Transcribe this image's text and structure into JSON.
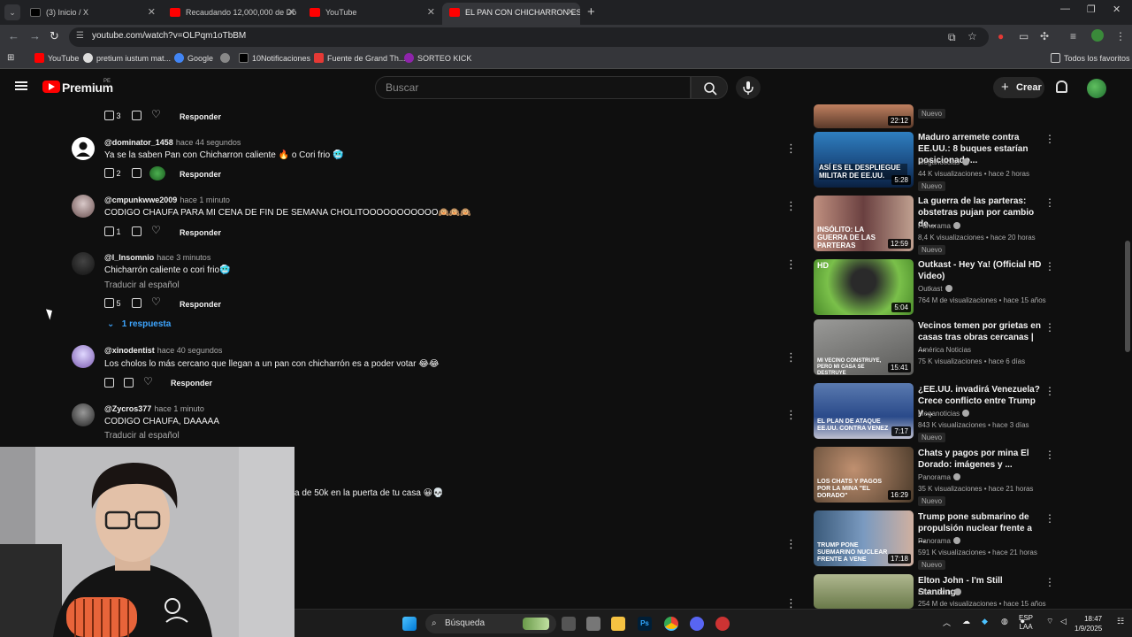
{
  "browser": {
    "tabs": [
      {
        "title": "(3) Inicio / X",
        "favicon": "x-logo-icon",
        "active": false
      },
      {
        "title": "Recaudando 12,000,000 de Dó",
        "favicon": "youtube-icon",
        "active": false
      },
      {
        "title": "YouTube",
        "favicon": "youtube-icon",
        "active": false
      },
      {
        "title": "EL PAN CON CHICHARRON ES",
        "favicon": "youtube-icon",
        "active": true
      }
    ],
    "url": "youtube.com/watch?v=OLPqm1oTbBM",
    "bookmarks": [
      {
        "label": "YouTube",
        "color": "#ff0000"
      },
      {
        "label": "pretium iustum mat...",
        "color": "#dddddd"
      },
      {
        "label": "Google",
        "color": "#4285f4"
      },
      {
        "label": "",
        "color": "#888888"
      },
      {
        "label": "10Notificaciones",
        "color": "#000000"
      },
      {
        "label": "Fuente de Grand Th...",
        "color": "#e53935"
      },
      {
        "label": "SORTEO KICK",
        "color": "#8e24aa"
      }
    ],
    "all_bookmarks": "Todos los favoritos"
  },
  "masthead": {
    "brand": "Premium",
    "country": "PE",
    "search_placeholder": "Buscar",
    "create_label": "Crear"
  },
  "comments": [
    {
      "author": "",
      "time": "",
      "text": "",
      "likes": "3",
      "reply": "Responder"
    },
    {
      "author": "@dominator_1458",
      "time": "hace 44 segundos",
      "text": "Ya se la saben Pan con Chicharron caliente 🔥 o Cori frio 🥶",
      "likes": "2",
      "reply": "Responder"
    },
    {
      "author": "@cmpunkwwe2009",
      "time": "hace 1 minuto",
      "text": "CODIGO CHAUFA PARA MI CENA DE FIN DE SEMANA CHOLITOOOOOOOOOOO🙉🙉🙉",
      "likes": "1",
      "reply": "Responder"
    },
    {
      "author": "@l_Insomnio",
      "time": "hace 3 minutos",
      "text": "Chicharrón caliente o cori frio🥶",
      "translate": "Traducir al español",
      "likes": "5",
      "reply": "Responder",
      "replies": "1 respuesta"
    },
    {
      "author": "@xinodentist",
      "time": "hace 40 segundos",
      "text": "Los cholos lo más cercano que llegan a un pan con chicharrón es a poder votar 😂😂",
      "likes": "",
      "reply": "Responder"
    },
    {
      "author": "@Zycros377",
      "time": "hace 1 minuto",
      "text": "CODIGO CHAUFA, DAAAAA",
      "translate": "Traducir al español"
    },
    {
      "author": "",
      "time": "",
      "text": "a de 50k en la puerta de tu casa 😀💀"
    }
  ],
  "sidebar": [
    {
      "title": "",
      "channel": "",
      "meta": "",
      "duration": "22:12",
      "badge": "Nuevo",
      "thumb": "#6a4a3a"
    },
    {
      "title": "Maduro arremete contra EE.UU.: 8 buques estarían posicionado...",
      "channel": "Meganoticias",
      "meta": "44 K visualizaciones • hace 2 horas",
      "duration": "5:28",
      "badge": "Nuevo",
      "thumb_text": "ASÍ ES EL DESPLIEGUE MILITAR DE EE.UU.",
      "thumb": "#2a6aa0"
    },
    {
      "title": "La guerra de las parteras: obstetras pujan por cambio de...",
      "channel": "Panorama",
      "meta": "8,4 K visualizaciones • hace 20 horas",
      "duration": "12:59",
      "badge": "Nuevo",
      "thumb_text": "INSÓLITO: LA GUERRA DE LAS PARTERAS",
      "thumb": "#8a5a5a"
    },
    {
      "title": "Outkast - Hey Ya! (Official HD Video)",
      "channel": "Outkast",
      "meta": "764 M de visualizaciones • hace 15 años",
      "duration": "5:04",
      "badge": "",
      "thumb_text": "HD",
      "thumb": "#7ac04a"
    },
    {
      "title": "Vecinos temen por grietas en casas tras obras cercanas | ...",
      "channel": "América Noticias",
      "meta": "75 K visualizaciones • hace 6 días",
      "duration": "15:41",
      "badge": "",
      "thumb_text": "MI VECINO CONSTRUYE, PERO MI CASA SE DESTRUYE",
      "thumb": "#7a7a78"
    },
    {
      "title": "¿EE.UU. invadirá Venezuela? Crece conflicto entre Trump y ...",
      "channel": "Meganoticias",
      "meta": "843 K visualizaciones • hace 3 días",
      "duration": "7:17",
      "badge": "Nuevo",
      "thumb_text": "EL PLAN DE ATAQUE EE.UU. CONTRA VENEZ",
      "thumb": "#3a5a9a"
    },
    {
      "title": "Chats y pagos por mina El Dorado: imágenes y ...",
      "channel": "Panorama",
      "meta": "35 K visualizaciones • hace 21 horas",
      "duration": "16:29",
      "badge": "Nuevo",
      "thumb_text": "LOS CHATS Y PAGOS POR LA MINA \"EL DORADO\"",
      "thumb": "#5a4a3a"
    },
    {
      "title": "Trump pone submarino de propulsión nuclear frente a ...",
      "channel": "Panorama",
      "meta": "591 K visualizaciones • hace 21 horas",
      "duration": "17:18",
      "badge": "Nuevo",
      "thumb_text": "TRUMP PONE SUBMARINO NUCLEAR FRENTE A VENE",
      "thumb": "#4a6a8a"
    },
    {
      "title": "Elton John - I'm Still Standing",
      "channel": "Elton John",
      "meta": "254 M de visualizaciones • hace 15 años",
      "duration": "",
      "badge": "",
      "thumb": "#9aa07a"
    }
  ],
  "taskbar": {
    "search_label": "Búsqueda",
    "lang": "ESP",
    "lang2": "LAA",
    "time": "18:47",
    "date": "1/9/2025"
  },
  "accent": "#3ea6ff",
  "brand_red": "#ff0000"
}
